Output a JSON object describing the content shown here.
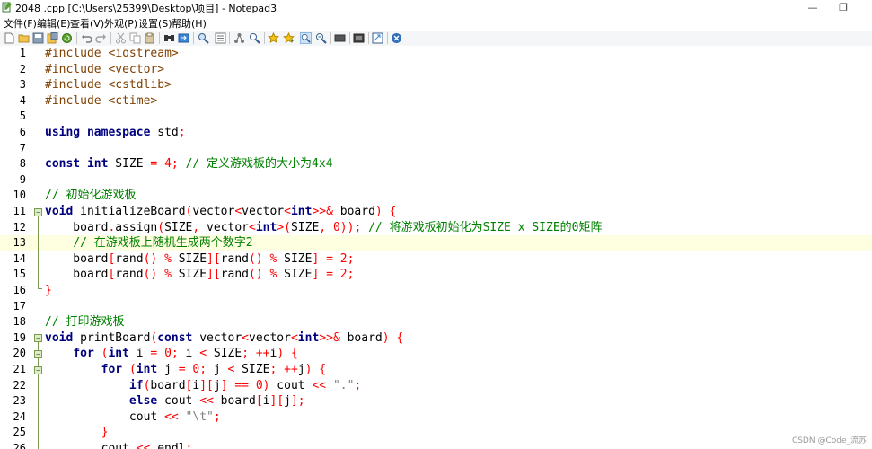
{
  "window": {
    "title": "2048 .cpp [C:\\Users\\25399\\Desktop\\项目] - Notepad3",
    "minimize_glyph": "—",
    "maximize_glyph": "❐"
  },
  "menu": [
    "文件(F)",
    "编辑(E)",
    "查看(V)",
    "外观(P)",
    "设置(S)",
    "帮助(H)"
  ],
  "toolbar_icons": [
    "new-file-icon",
    "open-folder-icon",
    "save-icon",
    "save-as-icon",
    "reload-icon",
    "undo-icon",
    "redo-icon",
    "cut-icon",
    "copy-icon",
    "paste-icon",
    "find-icon",
    "replace-icon",
    "find-next-icon",
    "goto-icon",
    "word-wrap-icon",
    "zoom-in-icon",
    "zoom-out-icon",
    "bookmark-icon",
    "bookmark-all-icon",
    "view-icon",
    "hex-view-icon",
    "doc-icon",
    "favorites-icon",
    "close-doc-icon"
  ],
  "watermark": "CSDN @Code_流苏",
  "code_lines": [
    "#include <iostream>",
    "#include <vector>",
    "#include <cstdlib>",
    "#include <ctime>",
    "",
    "using namespace std;",
    "",
    "const int SIZE = 4; // 定义游戏板的大小为4x4",
    "",
    "// 初始化游戏板",
    "void initializeBoard(vector<vector<int>>& board) {",
    "    board.assign(SIZE, vector<int>(SIZE, 0)); // 将游戏板初始化为SIZE x SIZE的0矩阵",
    "    // 在游戏板上随机生成两个数字2",
    "    board[rand() % SIZE][rand() % SIZE] = 2;",
    "    board[rand() % SIZE][rand() % SIZE] = 2;",
    "}",
    "",
    "// 打印游戏板",
    "void printBoard(const vector<vector<int>>& board) {",
    "    for (int i = 0; i < SIZE; ++i) {",
    "        for (int j = 0; j < SIZE; ++j) {",
    "            if(board[i][j] == 0) cout << \".\";",
    "            else cout << board[i][j];",
    "            cout << \"\\t\";",
    "        }",
    "        cout << endl;"
  ],
  "line_numbers": [
    "1",
    "2",
    "3",
    "4",
    "5",
    "6",
    "7",
    "8",
    "9",
    "10",
    "11",
    "12",
    "13",
    "14",
    "15",
    "16",
    "17",
    "18",
    "19",
    "20",
    "21",
    "22",
    "23",
    "24",
    "25",
    "26"
  ],
  "highlight_line": 13
}
